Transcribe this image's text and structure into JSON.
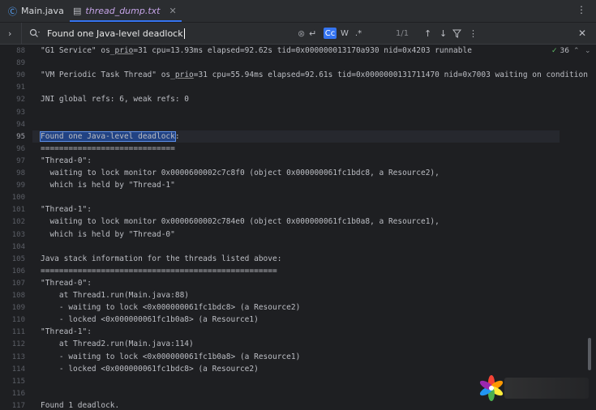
{
  "tabs": [
    {
      "label": "Main.java",
      "icon": "java-class-icon"
    },
    {
      "label": "thread_dump.txt",
      "icon": "text-file-icon"
    }
  ],
  "find": {
    "query": "Found one Java-level deadlock",
    "case_label": "Cc",
    "word_label": "W",
    "regex_label": ".*",
    "matches": "1/1"
  },
  "inspection": {
    "count": "36"
  },
  "lines": [
    {
      "num": "88",
      "text": "\"G1 Service\" os_prio=31 cpu=13.93ms elapsed=92.62s tid=0x000000013170a930 nid=0x4203 runnable"
    },
    {
      "num": "89",
      "text": ""
    },
    {
      "num": "90",
      "text": "\"VM Periodic Task Thread\" os_prio=31 cpu=55.94ms elapsed=92.61s tid=0x0000000131711470 nid=0x7003 waiting on condition"
    },
    {
      "num": "91",
      "text": ""
    },
    {
      "num": "92",
      "text": "JNI global refs: 6, weak refs: 0"
    },
    {
      "num": "93",
      "text": ""
    },
    {
      "num": "94",
      "text": ""
    },
    {
      "num": "95",
      "text": "Found one Java-level deadlock:"
    },
    {
      "num": "96",
      "text": "============================="
    },
    {
      "num": "97",
      "text": "\"Thread-0\":"
    },
    {
      "num": "98",
      "text": "  waiting to lock monitor 0x0000600002c7c8f0 (object 0x000000061fc1bdc8, a Resource2),"
    },
    {
      "num": "99",
      "text": "  which is held by \"Thread-1\""
    },
    {
      "num": "100",
      "text": ""
    },
    {
      "num": "101",
      "text": "\"Thread-1\":"
    },
    {
      "num": "102",
      "text": "  waiting to lock monitor 0x0000600002c784e0 (object 0x000000061fc1b0a8, a Resource1),"
    },
    {
      "num": "103",
      "text": "  which is held by \"Thread-0\""
    },
    {
      "num": "104",
      "text": ""
    },
    {
      "num": "105",
      "text": "Java stack information for the threads listed above:"
    },
    {
      "num": "106",
      "text": "==================================================="
    },
    {
      "num": "107",
      "text": "\"Thread-0\":"
    },
    {
      "num": "108",
      "text": "    at Thread1.run(Main.java:88)"
    },
    {
      "num": "109",
      "text": "    - waiting to lock <0x000000061fc1bdc8> (a Resource2)"
    },
    {
      "num": "110",
      "text": "    - locked <0x000000061fc1b0a8> (a Resource1)"
    },
    {
      "num": "111",
      "text": "\"Thread-1\":"
    },
    {
      "num": "112",
      "text": "    at Thread2.run(Main.java:114)"
    },
    {
      "num": "113",
      "text": "    - waiting to lock <0x000000061fc1b0a8> (a Resource1)"
    },
    {
      "num": "114",
      "text": "    - locked <0x000000061fc1bdc8> (a Resource2)"
    },
    {
      "num": "115",
      "text": ""
    },
    {
      "num": "116",
      "text": ""
    },
    {
      "num": "117",
      "text": "Found 1 deadlock."
    }
  ],
  "current_line": "95",
  "colors": {
    "accent": "#3574f0",
    "highlight": "#214283",
    "tab_active": "#c4a3e6"
  }
}
